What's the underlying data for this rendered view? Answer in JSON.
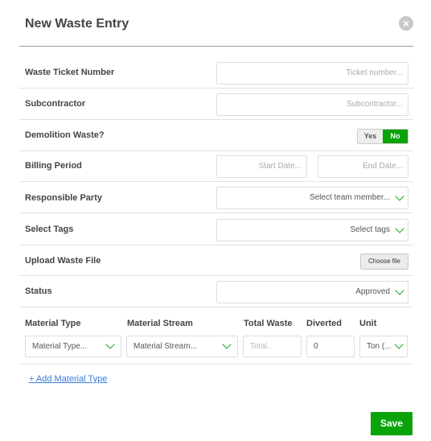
{
  "header": {
    "title": "New Waste Entry",
    "close_glyph": "×"
  },
  "fields": {
    "ticket": {
      "label": "Waste Ticket Number",
      "placeholder": "Ticket number..."
    },
    "subcontractor": {
      "label": "Subcontractor",
      "placeholder": "Subcontractor..."
    },
    "demolition": {
      "label": "Demolition Waste?",
      "yes": "Yes",
      "no": "No",
      "selected": "No"
    },
    "billing": {
      "label": "Billing Period",
      "start_placeholder": "Start Date...",
      "end_placeholder": "End Date..."
    },
    "responsible": {
      "label": "Responsible Party",
      "value": "Select team member..."
    },
    "tags": {
      "label": "Select Tags",
      "value": "Select tags"
    },
    "upload": {
      "label": "Upload Waste File",
      "button": "Choose file"
    },
    "status": {
      "label": "Status",
      "value": "Approved"
    }
  },
  "materials": {
    "headers": {
      "type": "Material Type",
      "stream": "Material Stream",
      "total": "Total Waste",
      "diverted": "Diverted",
      "unit": "Unit"
    },
    "row": {
      "type": "Material Type...",
      "stream": "Material Stream...",
      "total_placeholder": "Total..",
      "diverted": "0",
      "unit": "Ton (..."
    },
    "add_link": "+ Add Material Type"
  },
  "footer": {
    "save": "Save"
  },
  "colors": {
    "accent": "#0aa30a",
    "link": "#3a7bd5"
  }
}
